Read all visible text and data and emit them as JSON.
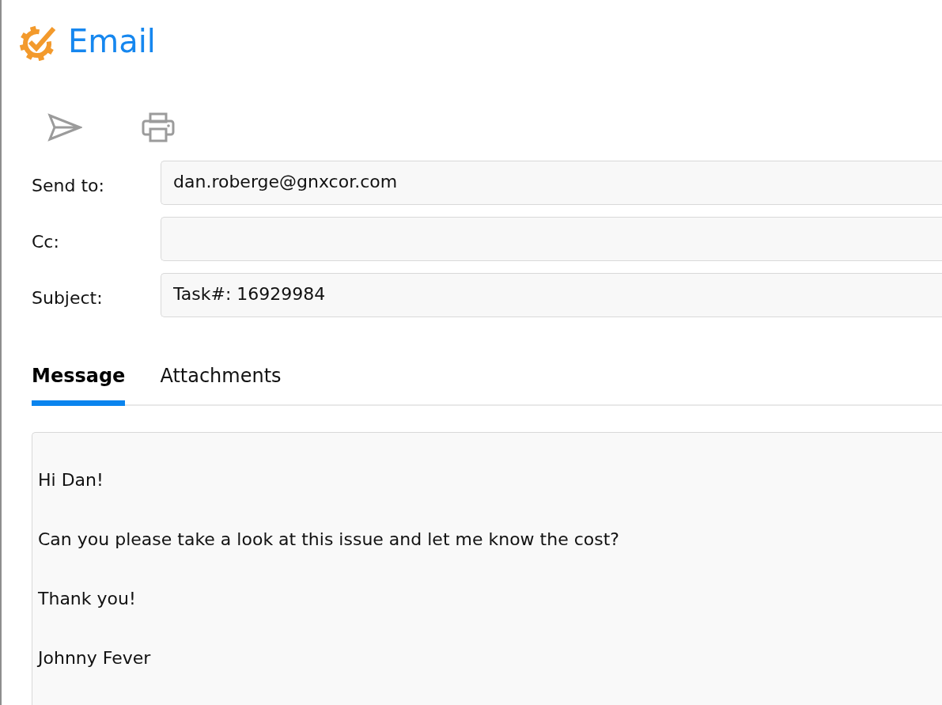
{
  "header": {
    "title": "Email"
  },
  "fields": [
    {
      "label": "Send to:",
      "value": "dan.roberge@gnxcor.com"
    },
    {
      "label": "Cc:"
    },
    {
      "label": "Subject:",
      "value": "Task#: 16929984"
    }
  ],
  "tabs": [
    {
      "label": "Message",
      "selected": true
    },
    {
      "label": "Attachments",
      "selected": false
    }
  ],
  "message": {
    "paragraphs": [
      "Hi Dan!",
      "Can you please take a look at this issue and let me know the cost?",
      "Thank you!",
      "Johnny Fever"
    ]
  }
}
